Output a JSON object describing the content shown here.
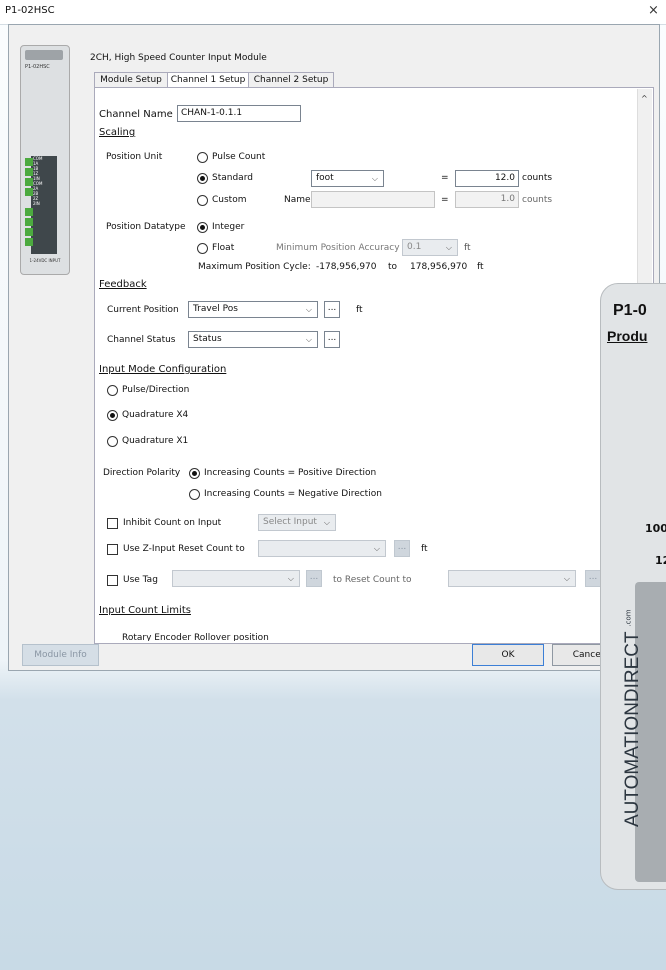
{
  "window": {
    "title": "P1-02HSC",
    "close_glyph": "×"
  },
  "module": {
    "description": "2CH, High Speed Counter Input Module",
    "label_top": "P1-02HSC",
    "label_bottom": "1-24VDC INPUT",
    "term_labels": [
      "COM",
      "1A",
      "1B",
      "1Z",
      "1IN",
      "COM",
      "2A",
      "2B",
      "2Z",
      "2IN"
    ]
  },
  "tabs": [
    {
      "label": "Module Setup",
      "active": false
    },
    {
      "label": "Channel 1 Setup",
      "active": true
    },
    {
      "label": "Channel 2 Setup",
      "active": false
    }
  ],
  "channel": {
    "label": "Channel Name",
    "value": "CHAN-1-0.1.1"
  },
  "scaling": {
    "heading": "Scaling",
    "position_unit_label": "Position Unit",
    "opt_pulse": "Pulse Count",
    "opt_standard": "Standard",
    "opt_custom": "Custom",
    "unit_select": "foot",
    "name_label": "Name",
    "eq": "=",
    "standard_counts": "12.0",
    "custom_counts": "1.0",
    "counts_unit": "counts",
    "datatype_label": "Position Datatype",
    "opt_integer": "Integer",
    "opt_float": "Float",
    "min_accuracy_label": "Minimum Position Accuracy",
    "min_accuracy_value": "0.1",
    "ft": "ft",
    "max_cycle_label": "Maximum Position Cycle:",
    "max_cycle_min": "-178,956,970",
    "to": "to",
    "max_cycle_max": "178,956,970",
    "selected_unit_option": "Standard",
    "selected_datatype": "Integer"
  },
  "feedback": {
    "heading": "Feedback",
    "current_pos_label": "Current Position",
    "current_pos_value": "Travel Pos",
    "ellipsis": "...",
    "ft": "ft",
    "status_label": "Channel Status",
    "status_value": "Status"
  },
  "input_mode": {
    "heading": "Input Mode Configuration",
    "opt_pulse_dir": "Pulse/Direction",
    "opt_quad_x4": "Quadrature X4",
    "opt_quad_x1": "Quadrature X1",
    "selected": "Quadrature X4",
    "direction_label": "Direction Polarity",
    "dir_positive": "Increasing Counts = Positive Direction",
    "dir_negative": "Increasing Counts = Negative Direction",
    "selected_direction": "positive"
  },
  "options": {
    "inhibit_label": "Inhibit Count on Input",
    "select_input": "Select Input",
    "zreset_label": "Use Z-Input Reset Count to",
    "use_tag_label": "Use Tag",
    "to_reset_label": "to Reset Count to",
    "ft": "ft",
    "ellipsis": "..."
  },
  "limits": {
    "heading": "Input Count Limits",
    "partial_row": "Rotary Encoder Rollover position"
  },
  "buttons": {
    "module_info": "Module Info",
    "ok": "OK",
    "cancel": "Cancel"
  },
  "device": {
    "model": "P1-0",
    "product": "Produ",
    "num1": "100",
    "num2": "12",
    "brand": "AUTOMATIONDIRECT",
    "com": ".com"
  },
  "colors": {
    "accent": "#4caa3f",
    "background_fade": "#c8dae6",
    "disabled_button": "#d5dee6"
  }
}
